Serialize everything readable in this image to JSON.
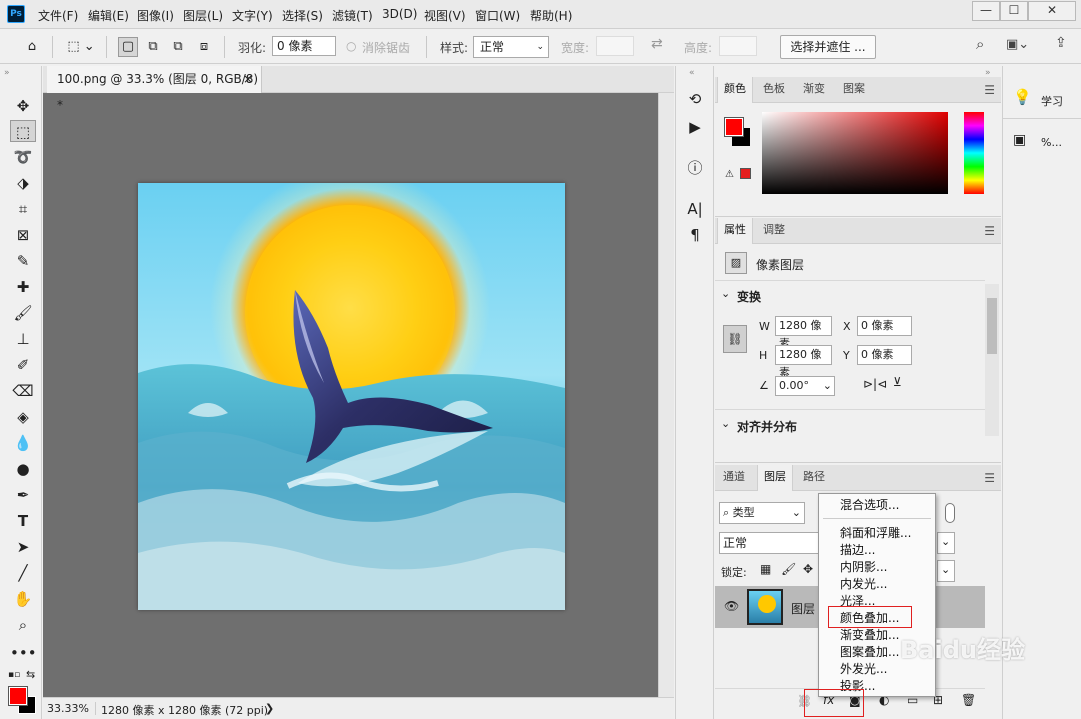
{
  "app": {
    "logo": "Ps"
  },
  "menu": [
    "文件(F)",
    "编辑(E)",
    "图像(I)",
    "图层(L)",
    "文字(Y)",
    "选择(S)",
    "滤镜(T)",
    "3D(D)",
    "视图(V)",
    "窗口(W)",
    "帮助(H)"
  ],
  "window_buttons": {
    "minimize": "—",
    "maximize": "☐",
    "close": "✕"
  },
  "options": {
    "feather_label": "羽化:",
    "feather_value": "0 像素",
    "antialias_label": "消除锯齿",
    "style_label": "样式:",
    "style_value": "正常",
    "width_label": "宽度:",
    "height_label": "高度:",
    "select_mask": "选择并遮住 ..."
  },
  "document": {
    "tab_title": "100.png @ 33.3% (图层 0, RGB/8) *",
    "tab_close": "×",
    "zoom": "33.33%",
    "info": "1280 像素 x 1280 像素 (72 ppi)",
    "arrow": "❯"
  },
  "color_panel": {
    "tabs": [
      "颜色",
      "色板",
      "渐变",
      "图案"
    ]
  },
  "props_panel": {
    "tabs": [
      "属性",
      "调整"
    ],
    "layer_type": "像素图层",
    "transform_title": "变换",
    "w_label": "W",
    "w_value": "1280 像素",
    "h_label": "H",
    "h_value": "1280 像素",
    "x_label": "X",
    "x_value": "0 像素",
    "y_label": "Y",
    "y_value": "0 像素",
    "angle_value": "0.00°",
    "align_title": "对齐并分布"
  },
  "layers_panel": {
    "tabs": [
      "通道",
      "图层",
      "路径"
    ],
    "filter_value": "类型",
    "blend_value": "正常",
    "lock_label": "锁定:",
    "layer_name": "图层"
  },
  "far_panel": {
    "learn": "学习",
    "item2": "%..."
  },
  "context_menu": {
    "items": [
      "混合选项...",
      "斜面和浮雕...",
      "描边...",
      "内阴影...",
      "内发光...",
      "光泽...",
      "颜色叠加...",
      "渐变叠加...",
      "图案叠加...",
      "外发光...",
      "投影..."
    ]
  },
  "watermark": "Baidu经验",
  "colors": {
    "foreground": "#ff0000",
    "background": "#000000",
    "highlight": "#e02020"
  }
}
